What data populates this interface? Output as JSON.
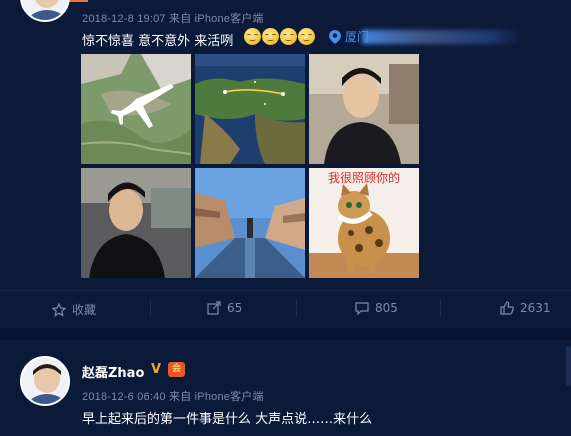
{
  "post1": {
    "meta": "2018-12-8 19:07 来自 iPhone客户端",
    "text": "惊不惊喜 意不意外 来活咧",
    "emojis": [
      "grin-icon",
      "grin-icon",
      "grin-icon",
      "grin-icon"
    ],
    "location": "厦门·",
    "images": [
      {
        "icon": "airplane-map-image"
      },
      {
        "icon": "flight-route-map-image"
      },
      {
        "icon": "selfie-image"
      },
      {
        "icon": "selfie-image"
      },
      {
        "icon": "canal-city-image"
      },
      {
        "icon": "cat-meme-image",
        "caption": "我很照顾你的"
      }
    ],
    "actions": {
      "favorite": "收藏",
      "forward": "65",
      "comment": "805",
      "like": "2631"
    }
  },
  "post2": {
    "username": "赵磊Zhao",
    "verified": "V",
    "member_badge": "会",
    "meta": "2018-12-6 06:40 来自 iPhone客户端",
    "text": "早上起来后的第一件事是什么 大声点说……来什么"
  },
  "colors": {
    "background": "#0c1a3a",
    "accent": "#e9742b",
    "link": "#4a8ce8",
    "muted": "#7f8ba5",
    "verified": "#f5a623"
  }
}
